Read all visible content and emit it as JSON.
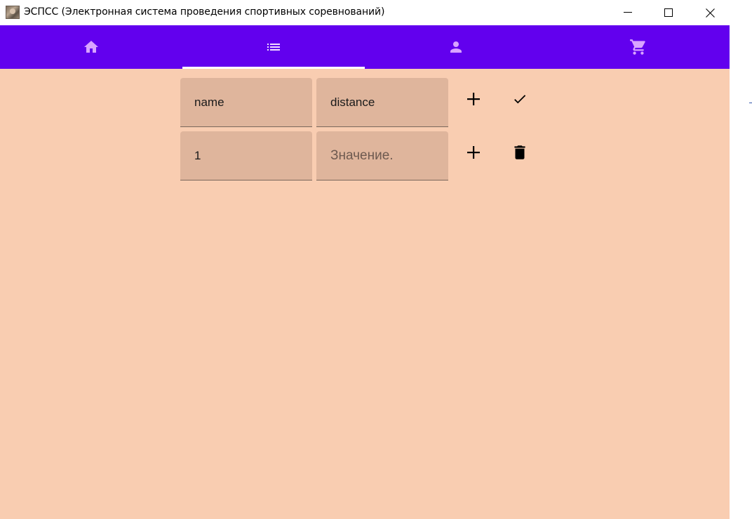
{
  "window": {
    "title": "ЭСПСС (Электронная система проведения спортивных соревнований)",
    "controls": [
      "minimize",
      "maximize",
      "close"
    ]
  },
  "nav": {
    "tabs": [
      {
        "icon": "home-icon",
        "selected": false
      },
      {
        "icon": "list-icon",
        "selected": true
      },
      {
        "icon": "person-icon",
        "selected": false
      },
      {
        "icon": "cart-icon",
        "selected": false
      }
    ],
    "color": "#6200ee",
    "icon_color": "#d9a3ff"
  },
  "form": {
    "header_row": {
      "name_value": "name",
      "distance_value": "distance",
      "add_icon": "plus-icon",
      "confirm_icon": "check-icon"
    },
    "data_row": {
      "name_value": "1",
      "value_placeholder": "Значение.",
      "add_icon": "plus-icon",
      "delete_icon": "trash-icon"
    }
  },
  "colors": {
    "background": "#f9cdb1",
    "field_fill": "#dfb59c"
  }
}
